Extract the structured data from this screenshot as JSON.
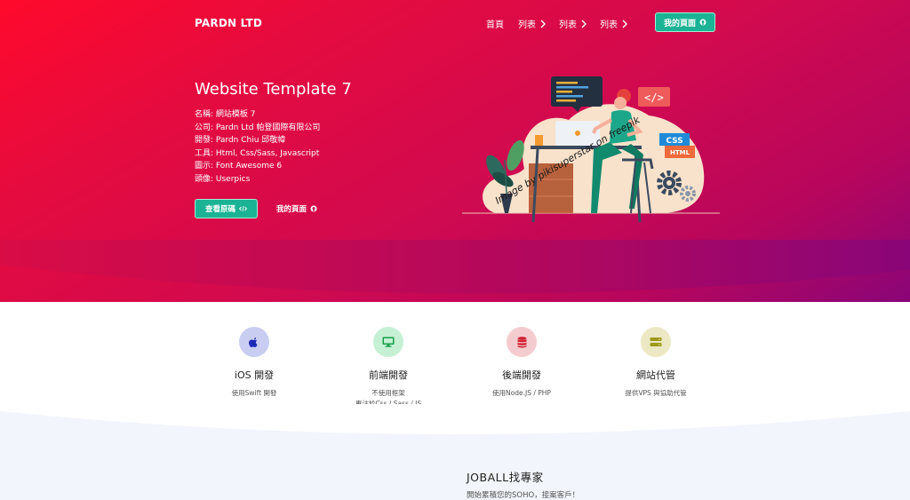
{
  "nav": {
    "brand": "PARDN LTD",
    "links": [
      {
        "label": "首頁"
      },
      {
        "label": "列表"
      },
      {
        "label": "列表"
      },
      {
        "label": "列表"
      }
    ],
    "cta_label": "我的頁面"
  },
  "hero": {
    "title": "Website Template 7",
    "info": [
      "名稱: 網站模板 7",
      "公司: Pardn Ltd 帕登國際有限公司",
      "開發: Pardn Chiu 邱敬幃",
      "工具: Html, Css/Sass, Javascript",
      "圖示: Font Awesome 6",
      "頭像: Userpics"
    ],
    "source_button": "查看原碼",
    "mypage_button": "我的頁面",
    "illustration": {
      "watermark": "Image by pikisuperstar on freepik",
      "badges": [
        "CSS",
        "HTML"
      ]
    }
  },
  "services": [
    {
      "title": "iOS 開發",
      "desc": [
        "使用Swift 開發"
      ],
      "icon": "apple-icon",
      "bg": "#c9cdf2",
      "fg": "#1d2bb8"
    },
    {
      "title": "前端開發",
      "desc": [
        "不使用框架",
        "專注於Css / Sass / JS"
      ],
      "icon": "desktop-icon",
      "bg": "#c6f0d4",
      "fg": "#17a04a"
    },
    {
      "title": "後端開發",
      "desc": [
        "使用Node.JS / PHP"
      ],
      "icon": "database-icon",
      "bg": "#f4cccf",
      "fg": "#d21f34"
    },
    {
      "title": "網站代管",
      "desc": [
        "提供VPS 與協助代管"
      ],
      "icon": "server-icon",
      "bg": "#ece8c4",
      "fg": "#9c9a17"
    }
  ],
  "joball": {
    "title": "JOBALL找專家",
    "subtitle": "開始累積您的SOHO，接案客戶！"
  },
  "colors": {
    "accent": "#1ab394",
    "hero_start": "#ff0a2c",
    "hero_end": "#8a0578"
  }
}
